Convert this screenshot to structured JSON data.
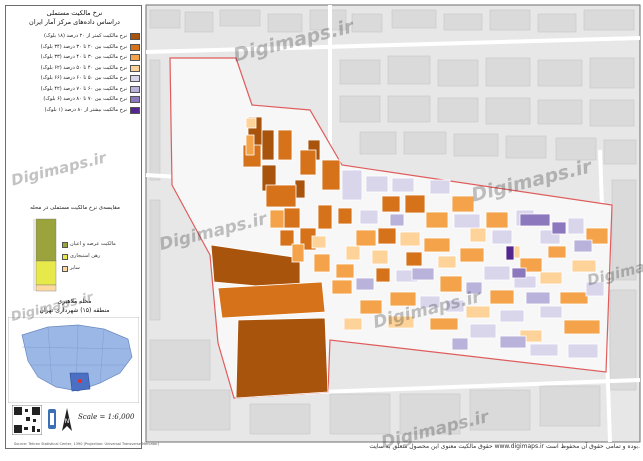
{
  "map": {
    "title_line1": "نرخ مالکیت مستملی",
    "title_line2": "دراساس داده‌های مرکز آمار ایران"
  },
  "legend": {
    "items": [
      {
        "label": "نرخ مالکیت کمتر از ۲۰ درصد (۱۸ بلوک)",
        "color": "#a9540d"
      },
      {
        "label": "نرخ مالکیت بین ۲۰ تا ۳۰ درصد (۳۴ بلوک)",
        "color": "#d6731a"
      },
      {
        "label": "نرخ مالکیت بین ۳۰ تا ۴۰ درصد (۳۳ بلوک)",
        "color": "#f4a34a"
      },
      {
        "label": "نرخ مالکیت بین ۴۰ تا ۵۰ درصد (۶۲ بلوک)",
        "color": "#fdd39a"
      },
      {
        "label": "نرخ مالکیت بین ۵۰ تا ۶۰ درصد (۶۶ بلوک)",
        "color": "#d9d6ec"
      },
      {
        "label": "نرخ مالکیت بین ۶۰ تا ۷۰ درصد (۴۲ بلوک)",
        "color": "#b9b3dc"
      },
      {
        "label": "نرخ مالکیت بین ۷۰ تا ۸۰ درصد (۶ بلوک)",
        "color": "#8b78bd"
      },
      {
        "label": "نرخ مالکیت بیشتر از ۸۰ درصد (۱ بلوک)",
        "color": "#54278f"
      }
    ]
  },
  "bar_chart": {
    "title": "مقایسه‌ی نرخ مالکیت مستملی در محله",
    "segments": [
      {
        "label": "مالکیت عرصه و اعیان",
        "color": "#9aa33c"
      },
      {
        "label": "رهن استیجاری",
        "color": "#e7e84a"
      },
      {
        "label": "سایر",
        "color": "#fdd9a0"
      }
    ]
  },
  "district": {
    "name": "محله ملاهیری",
    "region": "منطقه (۱۵) شهرداری تهران"
  },
  "scale": "Scale = 1:6,000",
  "credit": "Source: Tehran Statistical Center, 1390 (Projection: Universal Transverse Mercator)",
  "watermark": "Digimaps.ir",
  "footer": "حقوق مالکیت معنوی این محصول متعلق به سایت www.digimaps.ir بوده و تمامی حقوق آن محفوظ است."
}
